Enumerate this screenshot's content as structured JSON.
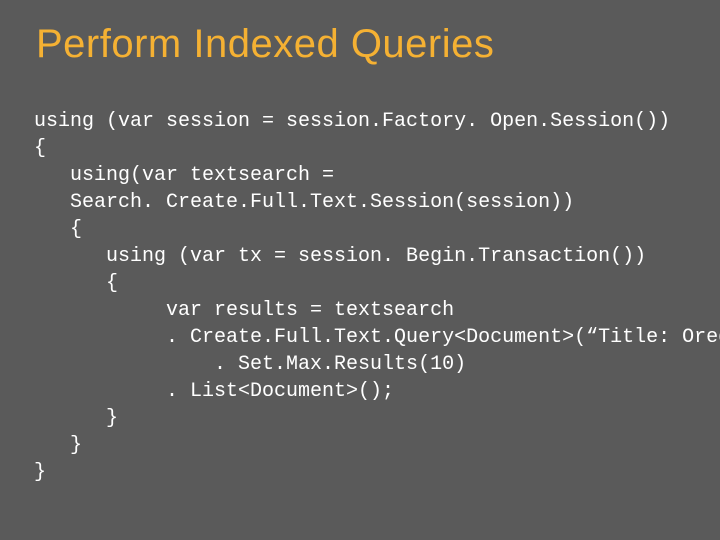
{
  "title": "Perform Indexed Queries",
  "code": {
    "l1": "using (var session = session.Factory. Open.Session())",
    "l2": "{",
    "l3": "   using(var textsearch =",
    "l4": "   Search. Create.Full.Text.Session(session))",
    "l5": "   {",
    "l6": "      using (var tx = session. Begin.Transaction())",
    "l7": "      {",
    "l8": "           var results = textsearch",
    "l9": "           . Create.Full.Text.Query<Document>(“Title: Oredev\")",
    "l10": "               . Set.Max.Results(10)",
    "l11": "           . List<Document>();",
    "l12": "      }",
    "l13": "   }",
    "l14": "}"
  }
}
